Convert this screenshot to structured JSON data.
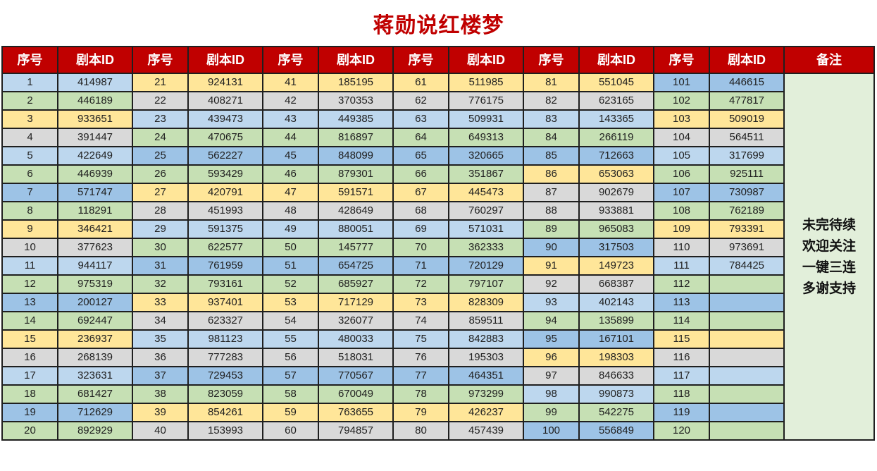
{
  "title": "蒋勋说红楼梦",
  "headers": [
    "序号",
    "剧本ID",
    "序号",
    "剧本ID",
    "序号",
    "剧本ID",
    "序号",
    "剧本ID",
    "序号",
    "剧本ID",
    "序号",
    "剧本ID",
    "备注"
  ],
  "note_lines": [
    "未完待续",
    "欢迎关注",
    "一键三连",
    "多谢支持"
  ],
  "colors": {
    "header_bg": "#c00000",
    "title": "#c00000",
    "blue_dark": "#9dc3e6",
    "blue_light": "#bdd7ee",
    "green": "#c6e0b4",
    "yellow": "#ffe699",
    "gray": "#d9d9d9",
    "note_bg": "#e2efda"
  },
  "groups": [
    {
      "nums": [
        "1",
        "2",
        "3",
        "4",
        "5",
        "6",
        "7",
        "8",
        "9",
        "10",
        "11",
        "12",
        "13",
        "14",
        "15",
        "16",
        "17",
        "18",
        "19",
        "20"
      ],
      "ids": [
        "414987",
        "446189",
        "933651",
        "391447",
        "422649",
        "446939",
        "571747",
        "118291",
        "346421",
        "377623",
        "944117",
        "975319",
        "200127",
        "692447",
        "236937",
        "268139",
        "323631",
        "681427",
        "712629",
        "892929"
      ],
      "colors": [
        "blue_light",
        "green",
        "yellow",
        "gray",
        "blue_light",
        "green",
        "blue_dark",
        "green",
        "yellow",
        "gray",
        "blue_light",
        "green",
        "blue_dark",
        "green",
        "yellow",
        "gray",
        "blue_light",
        "green",
        "blue_dark",
        "green"
      ]
    },
    {
      "nums": [
        "21",
        "22",
        "23",
        "24",
        "25",
        "26",
        "27",
        "28",
        "29",
        "30",
        "31",
        "32",
        "33",
        "34",
        "35",
        "36",
        "37",
        "38",
        "39",
        "40"
      ],
      "ids": [
        "924131",
        "408271",
        "439473",
        "470675",
        "562227",
        "593429",
        "420791",
        "451993",
        "591375",
        "622577",
        "761959",
        "793161",
        "937401",
        "623327",
        "981123",
        "777283",
        "729453",
        "823059",
        "854261",
        "153993"
      ],
      "colors": [
        "yellow",
        "gray",
        "blue_light",
        "green",
        "blue_dark",
        "green",
        "yellow",
        "gray",
        "blue_light",
        "green",
        "blue_dark",
        "green",
        "yellow",
        "gray",
        "blue_light",
        "gray",
        "blue_dark",
        "green",
        "yellow",
        "gray"
      ]
    },
    {
      "nums": [
        "41",
        "42",
        "43",
        "44",
        "45",
        "46",
        "47",
        "48",
        "49",
        "50",
        "51",
        "52",
        "53",
        "54",
        "55",
        "56",
        "57",
        "58",
        "59",
        "60"
      ],
      "ids": [
        "185195",
        "370353",
        "449385",
        "816897",
        "848099",
        "879301",
        "591571",
        "428649",
        "880051",
        "145777",
        "654725",
        "685927",
        "717129",
        "326077",
        "480033",
        "518031",
        "770567",
        "670049",
        "763655",
        "794857"
      ],
      "colors": [
        "yellow",
        "gray",
        "blue_light",
        "green",
        "blue_dark",
        "green",
        "yellow",
        "gray",
        "blue_light",
        "green",
        "blue_dark",
        "green",
        "yellow",
        "gray",
        "blue_light",
        "gray",
        "blue_dark",
        "green",
        "yellow",
        "gray"
      ]
    },
    {
      "nums": [
        "61",
        "62",
        "63",
        "64",
        "65",
        "66",
        "67",
        "68",
        "69",
        "70",
        "71",
        "72",
        "73",
        "74",
        "75",
        "76",
        "77",
        "78",
        "79",
        "80"
      ],
      "ids": [
        "511985",
        "776175",
        "509931",
        "649313",
        "320665",
        "351867",
        "445473",
        "760297",
        "571031",
        "362333",
        "720129",
        "797107",
        "828309",
        "859511",
        "842883",
        "195303",
        "464351",
        "973299",
        "426237",
        "457439"
      ],
      "colors": [
        "yellow",
        "gray",
        "blue_light",
        "green",
        "blue_dark",
        "green",
        "yellow",
        "gray",
        "blue_light",
        "green",
        "blue_dark",
        "green",
        "yellow",
        "gray",
        "blue_light",
        "gray",
        "blue_dark",
        "green",
        "yellow",
        "gray"
      ]
    },
    {
      "nums": [
        "81",
        "82",
        "83",
        "84",
        "85",
        "86",
        "87",
        "88",
        "89",
        "90",
        "91",
        "92",
        "93",
        "94",
        "95",
        "96",
        "97",
        "98",
        "99",
        "100"
      ],
      "ids": [
        "551045",
        "623165",
        "143365",
        "266119",
        "712663",
        "653063",
        "902679",
        "933881",
        "965083",
        "317503",
        "149723",
        "668387",
        "402143",
        "135899",
        "167101",
        "198303",
        "846633",
        "990873",
        "542275",
        "556849"
      ],
      "colors": [
        "yellow",
        "gray",
        "blue_light",
        "green",
        "blue_dark",
        "yellow",
        "gray",
        "gray",
        "green",
        "blue_dark",
        "yellow",
        "gray",
        "blue_light",
        "green",
        "blue_dark",
        "yellow",
        "gray",
        "blue_light",
        "green",
        "blue_dark"
      ]
    },
    {
      "nums": [
        "101",
        "102",
        "103",
        "104",
        "105",
        "106",
        "107",
        "108",
        "109",
        "110",
        "111",
        "112",
        "113",
        "114",
        "115",
        "116",
        "117",
        "118",
        "119",
        "120"
      ],
      "ids": [
        "446615",
        "477817",
        "509019",
        "564511",
        "317699",
        "925111",
        "730987",
        "762189",
        "793391",
        "973691",
        "784425",
        "",
        "",
        "",
        "",
        "",
        "",
        "",
        "",
        ""
      ],
      "colors": [
        "blue_dark",
        "green",
        "yellow",
        "gray",
        "blue_light",
        "green",
        "blue_dark",
        "green",
        "yellow",
        "gray",
        "blue_light",
        "green",
        "blue_dark",
        "green",
        "yellow",
        "gray",
        "blue_light",
        "green",
        "blue_dark",
        "green"
      ]
    }
  ]
}
